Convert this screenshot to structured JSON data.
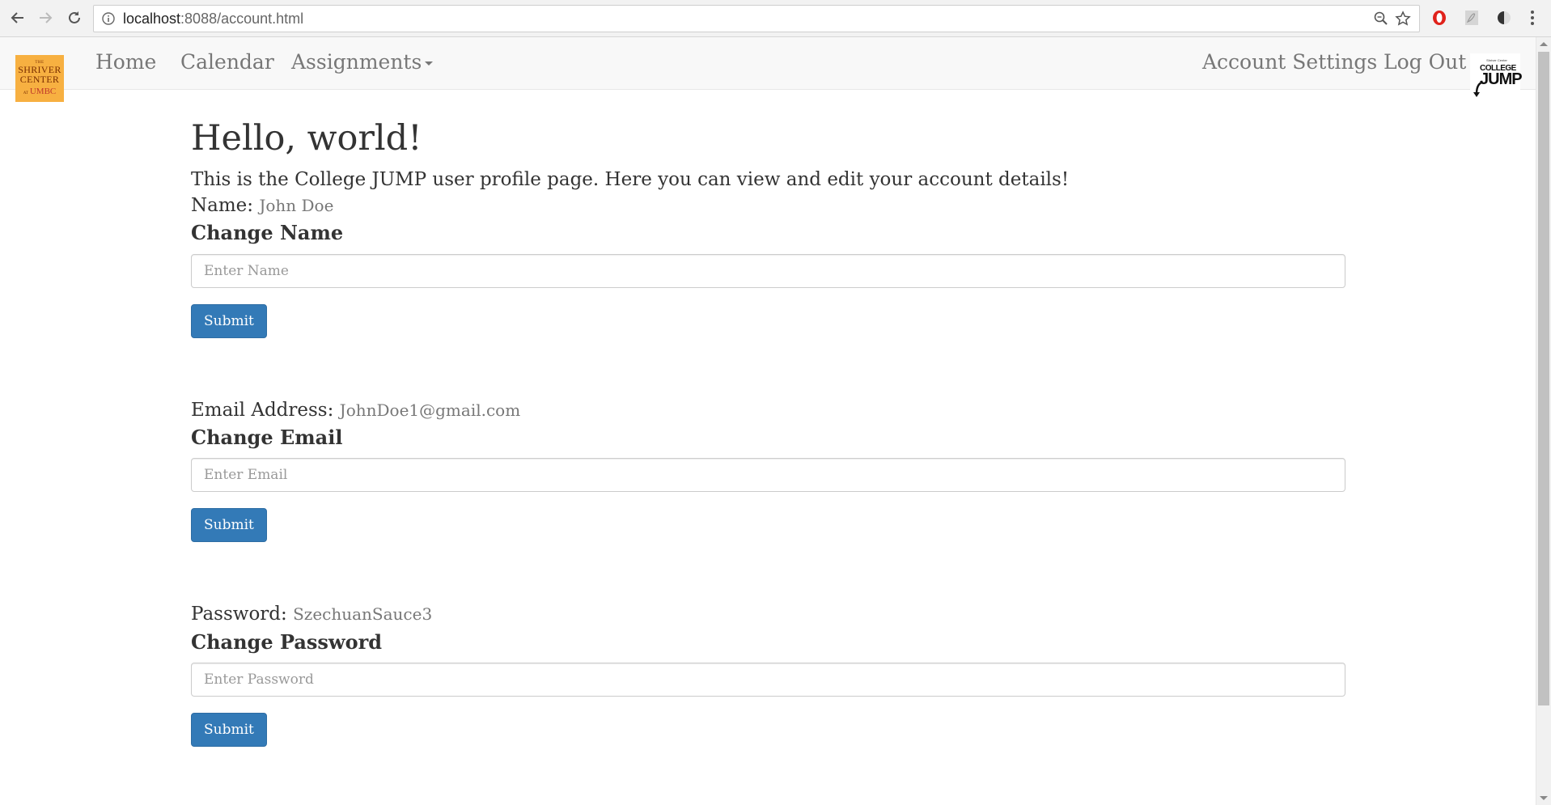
{
  "browser": {
    "url_host": "localhost",
    "url_path": ":8088/account.html"
  },
  "navbar": {
    "logo_left": {
      "the": "THE",
      "main1": "SHRIVER",
      "main2": "CENTER",
      "at": "AT",
      "umbc": "UMBC"
    },
    "links": {
      "home": "Home",
      "calendar": "Calendar",
      "assignments": "Assignments",
      "account_settings": "Account Settings",
      "log_out": "Log Out"
    },
    "logo_right": {
      "top": "Shriver Center",
      "college": "COLLEGE",
      "jump": "JUMP",
      "bottom": ""
    }
  },
  "page": {
    "heading": "Hello, world!",
    "lead": "This is the College JUMP user profile page. Here you can view and edit your account details!"
  },
  "sections": {
    "name": {
      "label": "Name:",
      "value": "John Doe",
      "title": "Change Name",
      "placeholder": "Enter Name",
      "submit": "Submit"
    },
    "email": {
      "label": "Email Address:",
      "value": "JohnDoe1@gmail.com",
      "title": "Change Email",
      "placeholder": "Enter Email",
      "submit": "Submit"
    },
    "password": {
      "label": "Password:",
      "value": "SzechuanSauce3",
      "title": "Change Password",
      "placeholder": "Enter Password",
      "submit": "Submit"
    }
  },
  "colors": {
    "primary": "#337ab7",
    "navbar_bg": "#f8f8f8",
    "logo_orange": "#f7b041",
    "opera_red": "#e0221b"
  },
  "icons": [
    "back-arrow-icon",
    "forward-arrow-icon",
    "reload-icon",
    "info-icon",
    "zoom-icon",
    "star-icon",
    "opera-icon",
    "pdf-icon",
    "dark-mode-icon",
    "kebab-menu-icon"
  ]
}
